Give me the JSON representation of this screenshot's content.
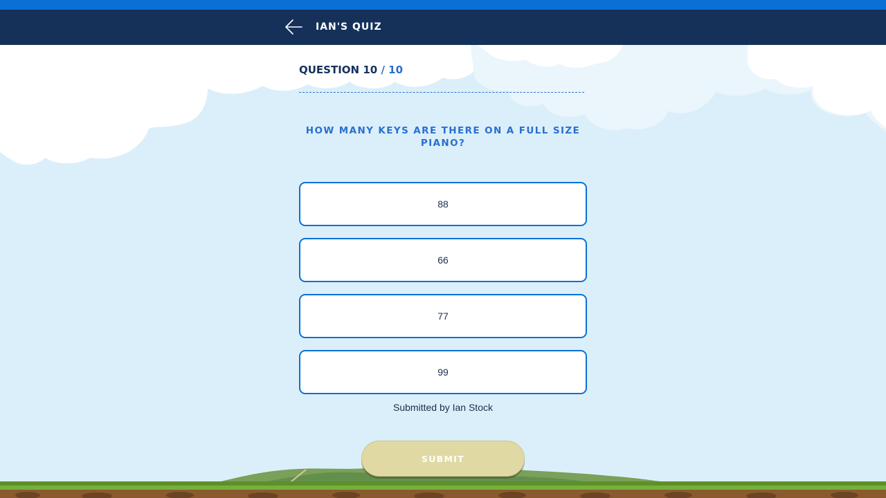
{
  "header": {
    "title": "Ian's Quiz",
    "back_icon": "arrow-left-icon"
  },
  "progress": {
    "label": "Question 10",
    "total": "/ 10"
  },
  "question": {
    "text": "How many keys are there on a full size piano?"
  },
  "answers": [
    {
      "label": "88"
    },
    {
      "label": "66"
    },
    {
      "label": "77"
    },
    {
      "label": "99"
    }
  ],
  "credit": "Submitted by Ian Stock",
  "submit_label": "Submit",
  "colors": {
    "navbar": "#15315a",
    "accent": "#0a70d6",
    "question_text": "#2a6fd0",
    "sky": "#dbeffa",
    "submit_disabled": "#e1d9a3"
  }
}
